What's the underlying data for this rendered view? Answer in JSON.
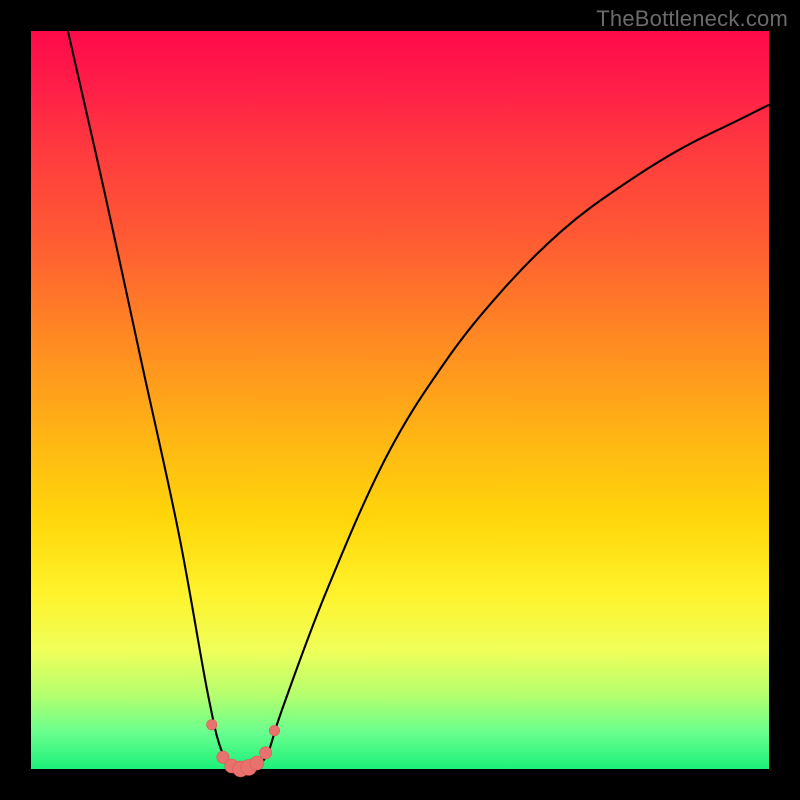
{
  "watermark": "TheBottleneck.com",
  "colors": {
    "frame_bg": "#000000",
    "curve_stroke": "#000000",
    "bead_fill": "#e9726e",
    "gradient_stops": [
      "#ff0a4a",
      "#ff3a3f",
      "#ff8a22",
      "#ffd60a",
      "#fff22a",
      "#b4ff6e",
      "#1cf07a"
    ]
  },
  "chart_data": {
    "type": "line",
    "title": "",
    "xlabel": "",
    "ylabel": "",
    "xlim": [
      0,
      100
    ],
    "ylim": [
      0,
      100
    ],
    "grid": false,
    "legend_position": "none",
    "annotations": [
      "TheBottleneck.com"
    ],
    "series": [
      {
        "name": "bottleneck-curve",
        "x": [
          5,
          10,
          15,
          20,
          24,
          26,
          28,
          30,
          32,
          34,
          40,
          48,
          56,
          64,
          72,
          80,
          88,
          96,
          100
        ],
        "y": [
          100,
          78,
          55,
          32,
          10,
          2,
          0,
          0,
          2,
          8,
          24,
          42,
          55,
          65,
          73,
          79,
          84,
          88,
          90
        ]
      }
    ],
    "highlight_points": {
      "name": "trough-beads",
      "x": [
        24.5,
        26.0,
        27.2,
        28.4,
        29.5,
        30.6,
        31.8,
        33.0
      ],
      "y": [
        6.0,
        1.6,
        0.4,
        0.0,
        0.2,
        0.8,
        2.2,
        5.2
      ]
    }
  }
}
